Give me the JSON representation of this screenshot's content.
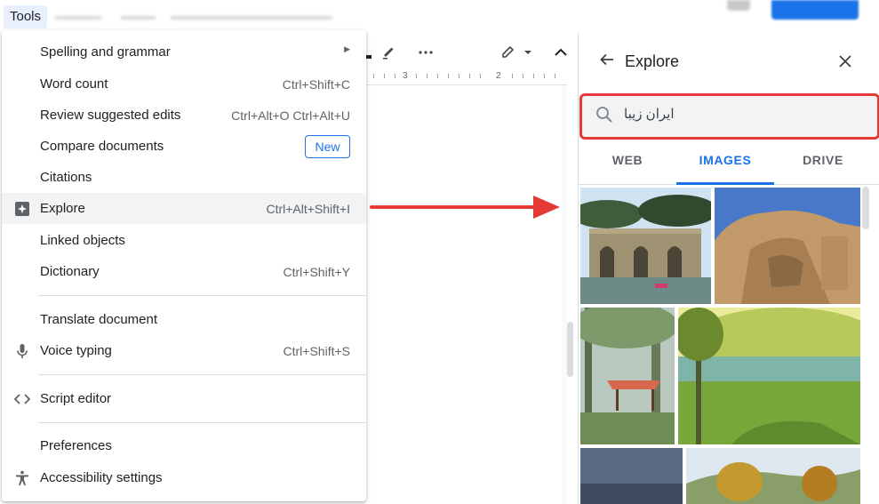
{
  "menubar": {
    "tools_label": "Tools"
  },
  "menu": {
    "items": [
      {
        "label": "Spelling and grammar",
        "shortcut": "",
        "has_submenu": true
      },
      {
        "label": "Word count",
        "shortcut": "Ctrl+Shift+C"
      },
      {
        "label": "Review suggested edits",
        "shortcut": "Ctrl+Alt+O Ctrl+Alt+U"
      },
      {
        "label": "Compare documents",
        "badge": "New"
      },
      {
        "label": "Citations",
        "shortcut": ""
      },
      {
        "label": "Explore",
        "shortcut": "Ctrl+Alt+Shift+I",
        "icon": "explore-icon",
        "active": true
      },
      {
        "label": "Linked objects",
        "shortcut": ""
      },
      {
        "label": "Dictionary",
        "shortcut": "Ctrl+Shift+Y"
      },
      {
        "label": "Translate document",
        "shortcut": ""
      },
      {
        "label": "Voice typing",
        "shortcut": "Ctrl+Shift+S",
        "icon": "microphone-icon"
      },
      {
        "label": "Script editor",
        "shortcut": "",
        "icon": "code-icon"
      },
      {
        "label": "Preferences",
        "shortcut": ""
      },
      {
        "label": "Accessibility settings",
        "shortcut": "",
        "icon": "accessibility-icon"
      }
    ]
  },
  "ruler": {
    "mark_a": "3",
    "mark_b": "2"
  },
  "explore": {
    "title": "Explore",
    "search_value": "ایران زیبا",
    "tabs": [
      {
        "label": "WEB",
        "selected": false
      },
      {
        "label": "IMAGES",
        "selected": true
      },
      {
        "label": "DRIVE",
        "selected": false
      }
    ]
  },
  "colors": {
    "accent": "#1a73e8",
    "highlight_box": "#e53935",
    "arrow": "#e53935"
  }
}
